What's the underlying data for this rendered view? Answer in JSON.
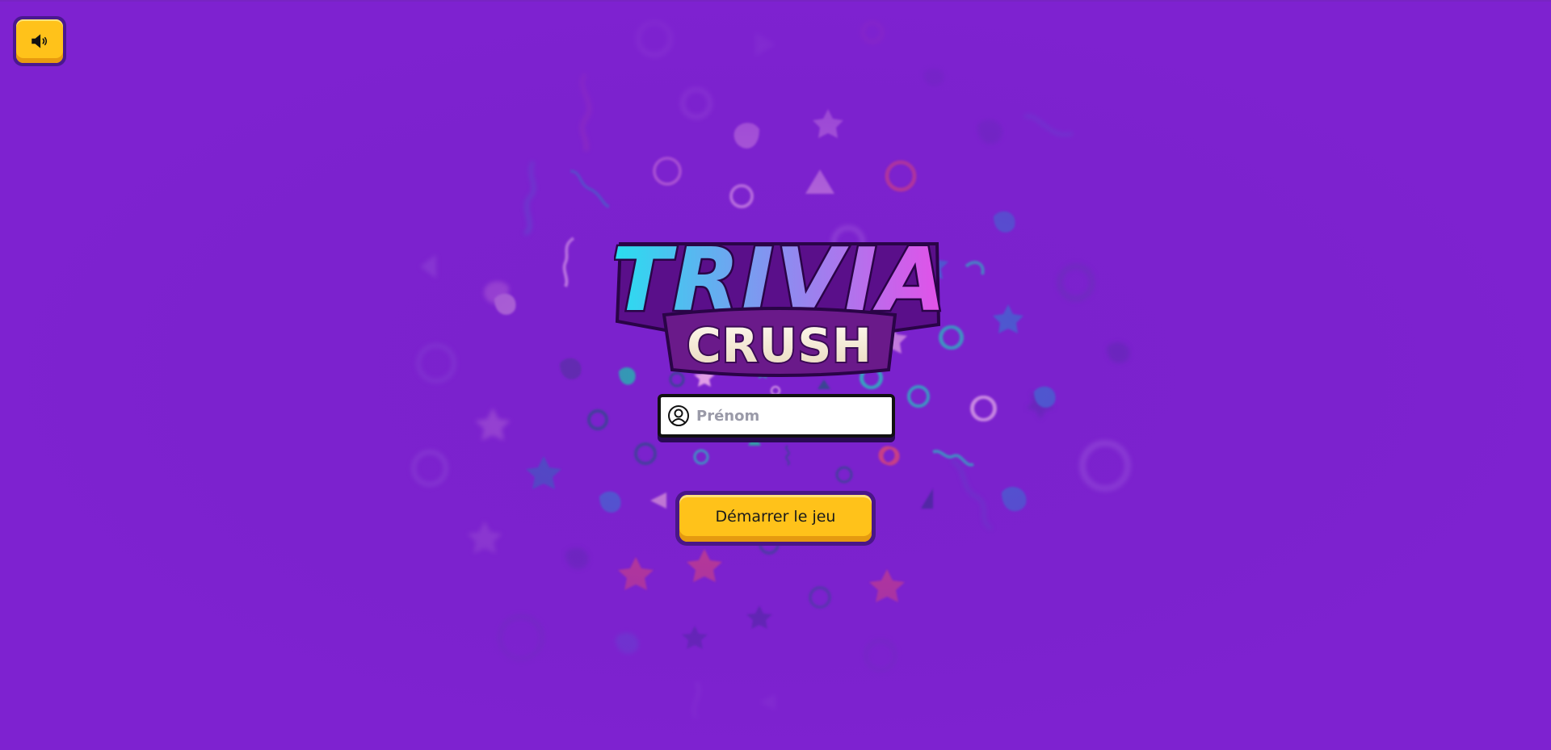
{
  "app": {
    "logo_text_line1": "TRIVIA",
    "logo_text_line2": "CRUSH"
  },
  "controls": {
    "sound_toggle_icon": "speaker-icon",
    "name_input": {
      "placeholder": "Prénom",
      "value": "",
      "icon": "user-icon"
    },
    "start_label": "Démarrer le jeu"
  },
  "colors": {
    "background": "#7b22cd",
    "button_yellow": "#ffc21a",
    "button_border": "#4a1688",
    "logo_gradient_start": "#27e0f0",
    "logo_gradient_end": "#e64fe8",
    "logo_crush_fill": "#f6ead6"
  }
}
